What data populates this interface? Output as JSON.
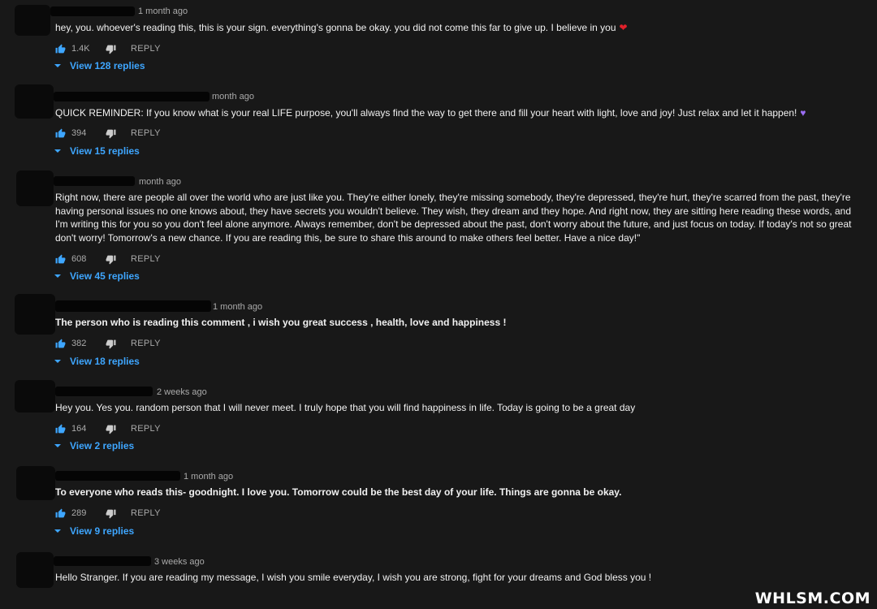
{
  "comments": [
    {
      "time": "1 month ago",
      "text": "hey, you. whoever's reading this, this is your sign. everything's gonna be okay. you did not come this far to give up. I believe in you",
      "emoji": "❤",
      "emoji_color": "#e0202a",
      "likes": "1.4K",
      "reply_label": "REPLY",
      "view_replies": "View 128 replies"
    },
    {
      "time": "month ago",
      "text": "QUICK REMINDER: If you know what is your real LIFE purpose, you'll always find the way to get there and fill your heart with light, love and joy! Just relax and let it happen!",
      "emoji": "♥",
      "emoji_color": "#9b6ef3",
      "likes": "394",
      "reply_label": "REPLY",
      "view_replies": "View 15 replies"
    },
    {
      "time": "month ago",
      "text": "Right now, there are people all over the world who are just like you. They're either lonely, they're missing somebody, they're depressed, they're hurt, they're scarred from the past, they're having personal issues no one knows about, they have secrets you wouldn't believe. They wish, they dream and they hope. And right now, they are sitting here reading these words, and I'm writing this for you so you don't feel alone anymore. Always remember, don't be depressed about the past, don't worry about the future, and just focus on today. If today's not so great don't worry! Tomorrow's a new chance. If you are reading this, be sure to share this around to make others feel better. Have a nice day!\"",
      "likes": "608",
      "reply_label": "REPLY",
      "view_replies": "View 45 replies"
    },
    {
      "time": "1 month ago",
      "text": "The person who is reading this comment , i wish you great success , health, love and happiness !",
      "likes": "382",
      "reply_label": "REPLY",
      "view_replies": "View 18 replies"
    },
    {
      "time": "2 weeks ago",
      "text": "Hey you. Yes you. random person that I will never meet. I truly hope that you will find happiness in life. Today is going to be a great day",
      "likes": "164",
      "reply_label": "REPLY",
      "view_replies": "View 2 replies"
    },
    {
      "time": "1 month ago",
      "text": "To everyone who reads this- goodnight. I love you. Tomorrow could be the best day of your life. Things are gonna be okay.",
      "likes": "289",
      "reply_label": "REPLY",
      "view_replies": "View 9 replies"
    },
    {
      "time": "3 weeks ago",
      "text": "Hello Stranger. If you are reading my message, I wish you smile everyday, I wish you are strong, fight for your dreams and God bless you !"
    }
  ],
  "watermark": "WHLSM.COM",
  "colors": {
    "link": "#3ea6ff",
    "like_icon": "#3ea6ff",
    "background": "#181818"
  }
}
